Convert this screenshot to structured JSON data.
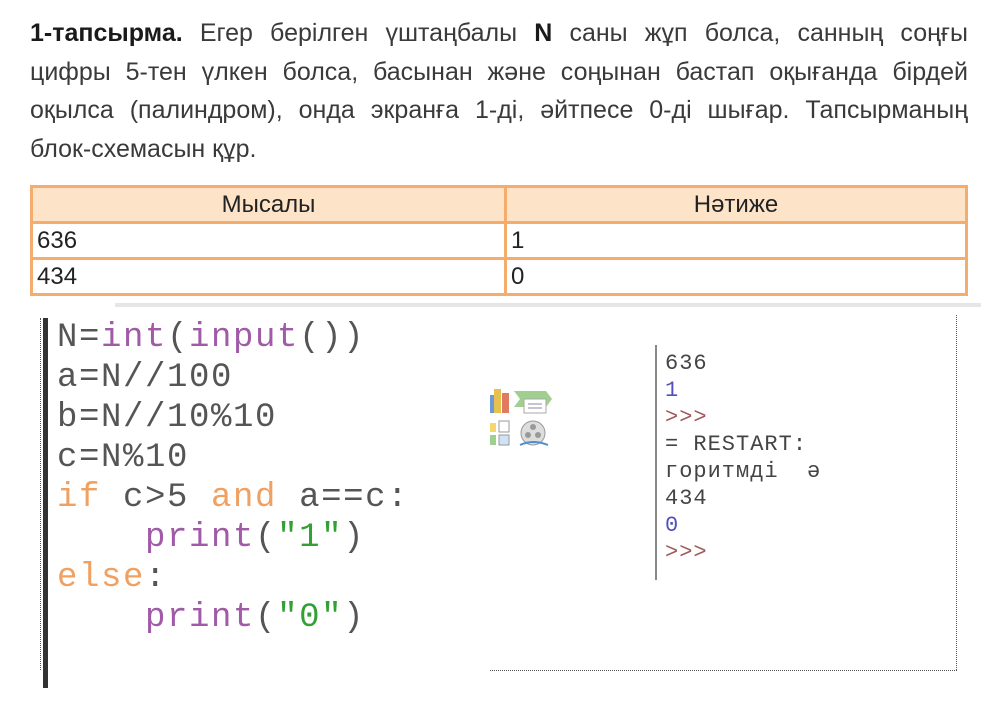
{
  "task": {
    "label": "1-тапсырма.",
    "lines": [
      {
        "before": " Егер берілген үштаңбалы ",
        "bold": "N",
        "after": " саны жұп болса, санның соңғы"
      },
      "цифры 5-тен үлкен болса, басынан және соңынан бастап оқығанда бірдей",
      "оқылса (палиндром), онда экранға 1-ді, әйтпесе 0-ді шығар. Тапсырманың",
      "блок-схемасын құр."
    ]
  },
  "table": {
    "headers": [
      "Мысалы",
      "Нәтиже"
    ],
    "rows": [
      [
        "636",
        "1"
      ],
      [
        "434",
        "0"
      ]
    ]
  },
  "code": {
    "lines": [
      [
        [
          "N=",
          ""
        ],
        [
          "int",
          "bi"
        ],
        [
          "(",
          ""
        ],
        [
          "input",
          "bi"
        ],
        [
          "())",
          ""
        ]
      ],
      [
        [
          "a=N//100",
          ""
        ]
      ],
      [
        [
          "b=N//10%10",
          ""
        ]
      ],
      [
        [
          "c=N%10",
          ""
        ]
      ],
      [
        [
          "if",
          "kw"
        ],
        [
          " c>5 ",
          ""
        ],
        [
          "and",
          "kw"
        ],
        [
          " a==c:",
          ""
        ]
      ],
      [
        [
          "    ",
          ""
        ],
        [
          "print",
          "bi"
        ],
        [
          "(",
          ""
        ],
        [
          "\"1\"",
          "st"
        ],
        [
          ")",
          ""
        ]
      ],
      [
        [
          "else",
          "kw"
        ],
        [
          ":",
          ""
        ]
      ],
      [
        [
          "    ",
          ""
        ],
        [
          "print",
          "bi"
        ],
        [
          "(",
          ""
        ],
        [
          "\"0\"",
          "st"
        ],
        [
          ")",
          ""
        ]
      ]
    ]
  },
  "output": {
    "lines": [
      [
        "636",
        ""
      ],
      [
        "1",
        "blue"
      ],
      [
        ">>>",
        "prm"
      ],
      [
        "= RESTART:",
        ""
      ],
      [
        "горитмді  ә",
        ""
      ],
      [
        "434",
        ""
      ],
      [
        "0",
        "blue"
      ],
      [
        ">>>",
        "prm"
      ]
    ]
  },
  "colors": {
    "table_border": "#f5ad6e",
    "table_header": "#fde3c8",
    "keyword": "#f0a060",
    "builtin": "#a05aa8",
    "string": "#33a033"
  }
}
